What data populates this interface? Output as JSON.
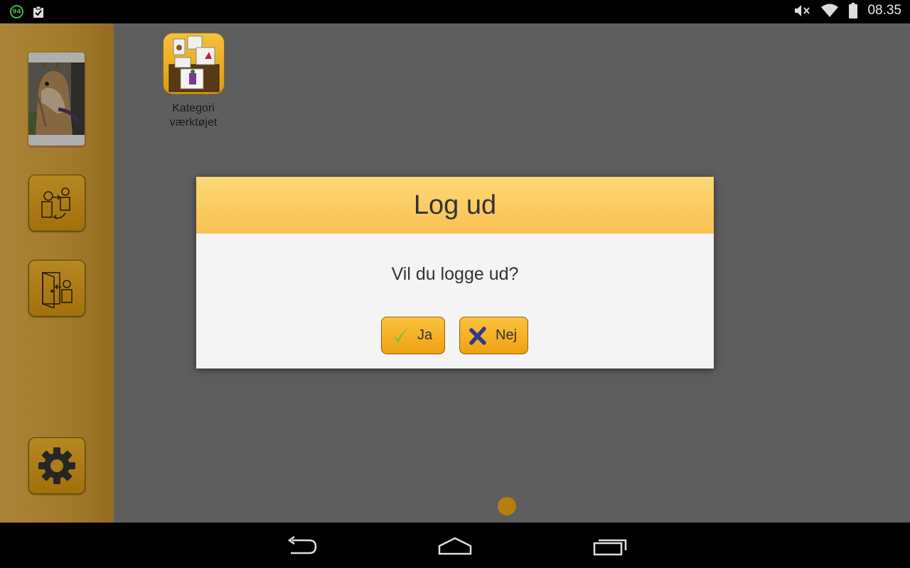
{
  "statusbar": {
    "notification_badge": "94",
    "time": "08.35",
    "icons": [
      "app-badge-icon",
      "clipboard-icon",
      "volume-muted-icon",
      "wifi-icon",
      "battery-icon"
    ]
  },
  "sidebar": {
    "buttons": [
      "switch-user-icon",
      "logout-door-icon",
      "gear-icon"
    ]
  },
  "main": {
    "app_label": "Kategori værktøjet"
  },
  "dialog": {
    "title": "Log ud",
    "message": "Vil du logge ud?",
    "yes_label": "Ja",
    "no_label": "Nej"
  },
  "navbar": {
    "icons": [
      "back-icon",
      "home-icon",
      "recent-apps-icon"
    ]
  },
  "colors": {
    "accent": "#f2b62f",
    "dialog_header": "#fdd876",
    "overlay_gray": "#5e5e5e"
  }
}
